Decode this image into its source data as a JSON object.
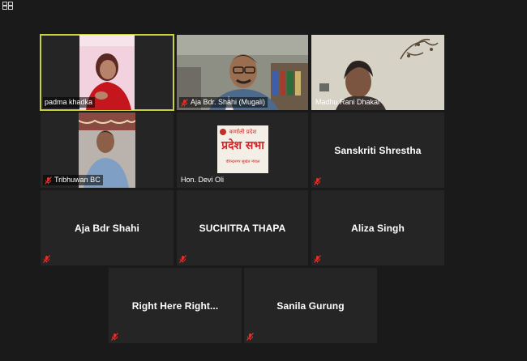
{
  "app": {
    "icon": "zoom-grid-icon"
  },
  "colors": {
    "background": "#1a1a1a",
    "tile": "#252525",
    "active_border": "#c9d03c",
    "muted_icon": "#e0312d"
  },
  "participants": [
    {
      "name": "padma khadka",
      "video": true,
      "muted": false,
      "active": true
    },
    {
      "name": "Aja Bdr. Shahi (Mugali)",
      "video": true,
      "muted": true
    },
    {
      "name": "Madhu Rani Dhakal",
      "video": true,
      "muted": false
    },
    {
      "name": "Tribhuwan BC",
      "video": true,
      "muted": true
    },
    {
      "name": "Hon. Devi Oli",
      "video": true,
      "muted": false,
      "banner_text": [
        "कर्णाली प्रदेश",
        "प्रदेश सभा",
        "वीरेन्द्रनगर सुर्खेत नेपाल"
      ]
    },
    {
      "name": "Sanskriti Shrestha",
      "video": false,
      "muted": true
    },
    {
      "name": "Aja Bdr Shahi",
      "video": false,
      "muted": true
    },
    {
      "name": "SUCHITRA THAPA",
      "video": false,
      "muted": true
    },
    {
      "name": "Aliza Singh",
      "video": false,
      "muted": true
    },
    {
      "name": "Right Here Right...",
      "video": false,
      "muted": true
    },
    {
      "name": "Sanila Gurung",
      "video": false,
      "muted": true
    }
  ]
}
